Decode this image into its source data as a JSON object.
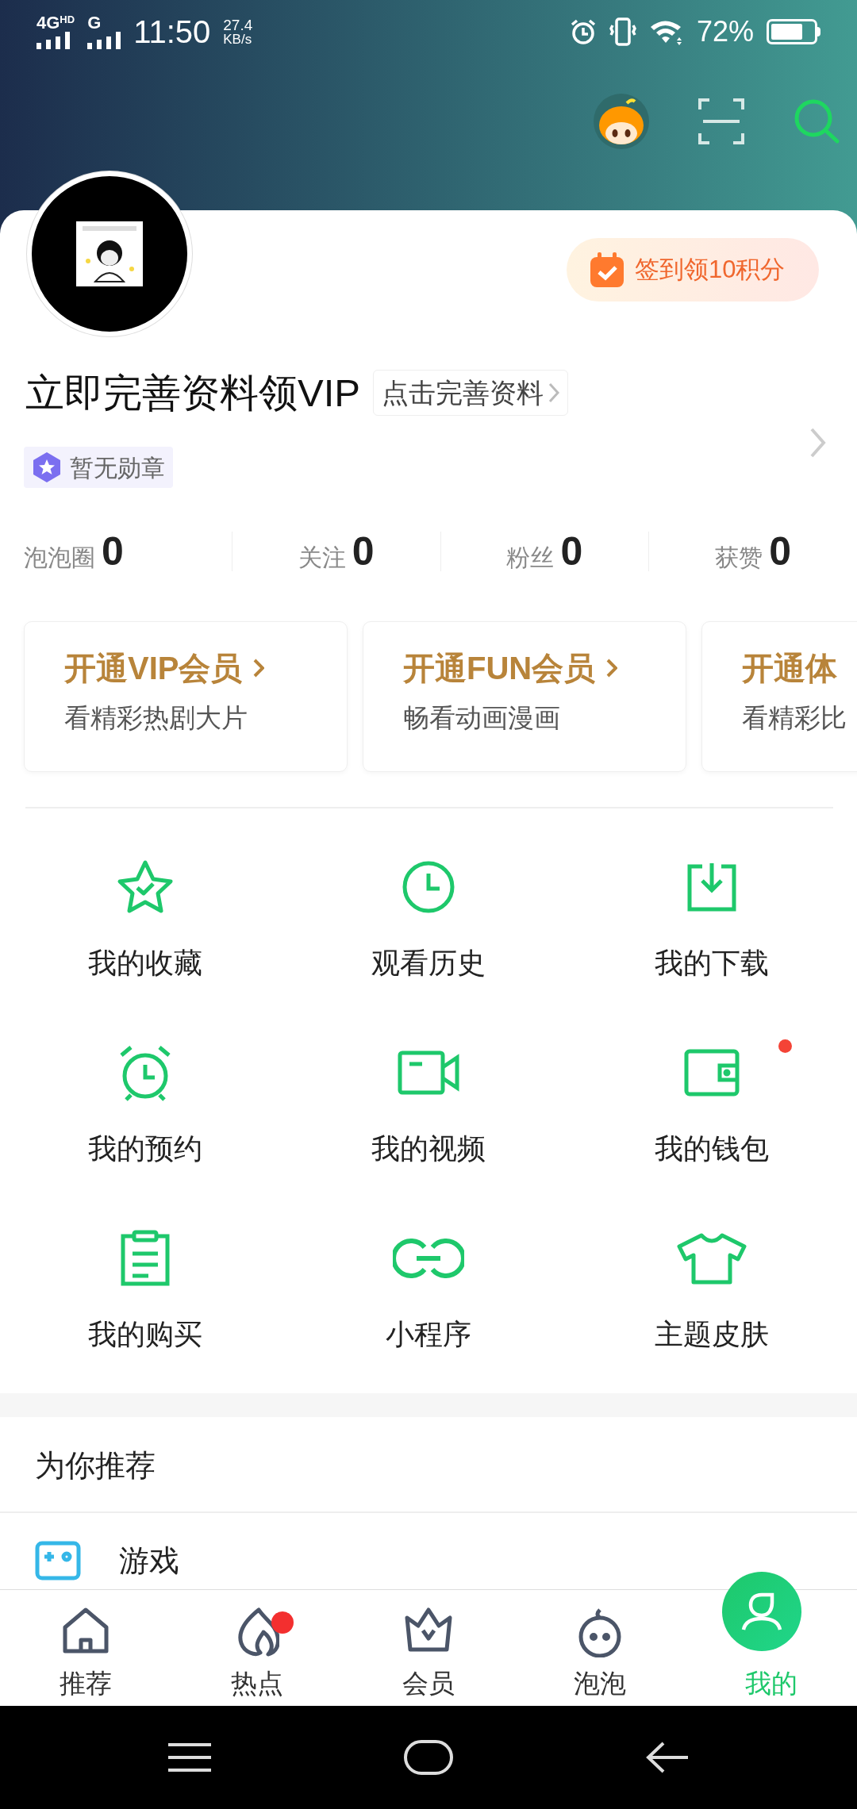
{
  "status_bar": {
    "network_1": "4G",
    "network_1_sup": "HD",
    "network_2": "G",
    "time": "11:50",
    "speed": "27.4",
    "speed_unit": "KB/s",
    "battery": "72%"
  },
  "profile": {
    "sign_in_button": "签到领10积分",
    "name": "立即完善资料领VIP",
    "complete_link": "点击完善资料",
    "medal": "暂无勋章"
  },
  "stats": [
    {
      "label": "泡泡圈",
      "value": "0"
    },
    {
      "label": "关注",
      "value": "0"
    },
    {
      "label": "粉丝",
      "value": "0"
    },
    {
      "label": "获赞",
      "value": "0"
    }
  ],
  "member_cards": [
    {
      "title": "开通VIP会员",
      "subtitle": "看精彩热剧大片",
      "arrow": true
    },
    {
      "title": "开通FUN会员",
      "subtitle": "畅看动画漫画",
      "arrow": true
    },
    {
      "title": "开通体",
      "subtitle": "看精彩比",
      "arrow": false
    }
  ],
  "features": [
    {
      "label": "我的收藏",
      "badge": false
    },
    {
      "label": "观看历史",
      "badge": false
    },
    {
      "label": "我的下载",
      "badge": false
    },
    {
      "label": "我的预约",
      "badge": false
    },
    {
      "label": "我的视频",
      "badge": false
    },
    {
      "label": "我的钱包",
      "badge": true
    },
    {
      "label": "我的购买",
      "badge": false
    },
    {
      "label": "小程序",
      "badge": false
    },
    {
      "label": "主题皮肤",
      "badge": false
    }
  ],
  "recommend": {
    "title": "为你推荐",
    "items": [
      {
        "label": "游戏"
      }
    ]
  },
  "tab_bar": [
    {
      "label": "推荐",
      "selected": false,
      "badge": false
    },
    {
      "label": "热点",
      "selected": false,
      "badge": true
    },
    {
      "label": "会员",
      "selected": false,
      "badge": false
    },
    {
      "label": "泡泡",
      "selected": false,
      "badge": false
    },
    {
      "label": "我的",
      "selected": true,
      "badge": false
    }
  ]
}
